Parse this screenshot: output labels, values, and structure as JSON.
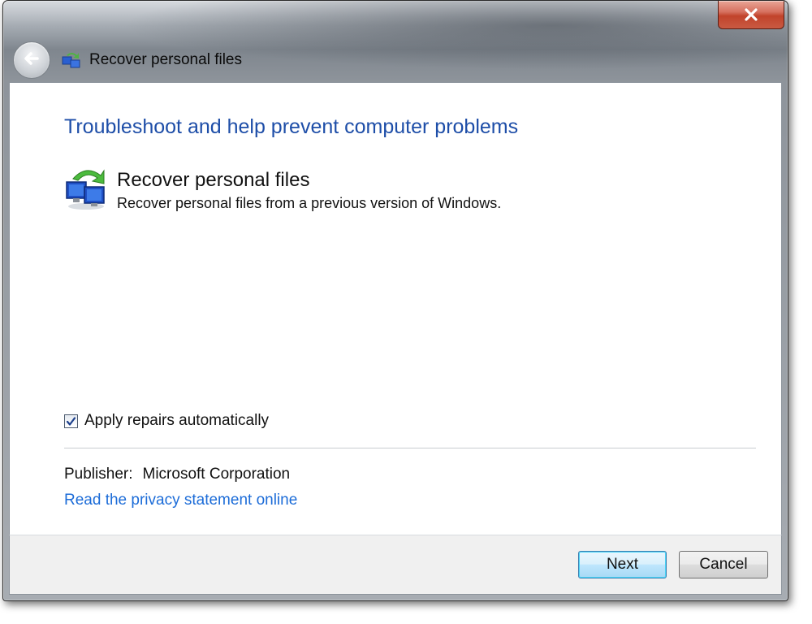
{
  "window": {
    "title": "Recover personal files",
    "title_icon": "troubleshoot-icon",
    "close_icon": "close-icon",
    "back_icon": "back-arrow-icon"
  },
  "main": {
    "heading": "Troubleshoot and help prevent computer problems",
    "tool": {
      "icon": "network-computers-icon",
      "title": "Recover personal files",
      "description": "Recover personal files from a previous version of Windows."
    },
    "apply_repairs": {
      "label": "Apply repairs automatically",
      "checked": true
    },
    "publisher": {
      "label": "Publisher:",
      "value": "Microsoft Corporation"
    },
    "privacy_link": "Read the privacy statement online"
  },
  "footer": {
    "next_label": "Next",
    "cancel_label": "Cancel"
  },
  "colors": {
    "heading": "#1e4ea8",
    "link": "#1c6cd8",
    "close_button": "#c1432b"
  }
}
